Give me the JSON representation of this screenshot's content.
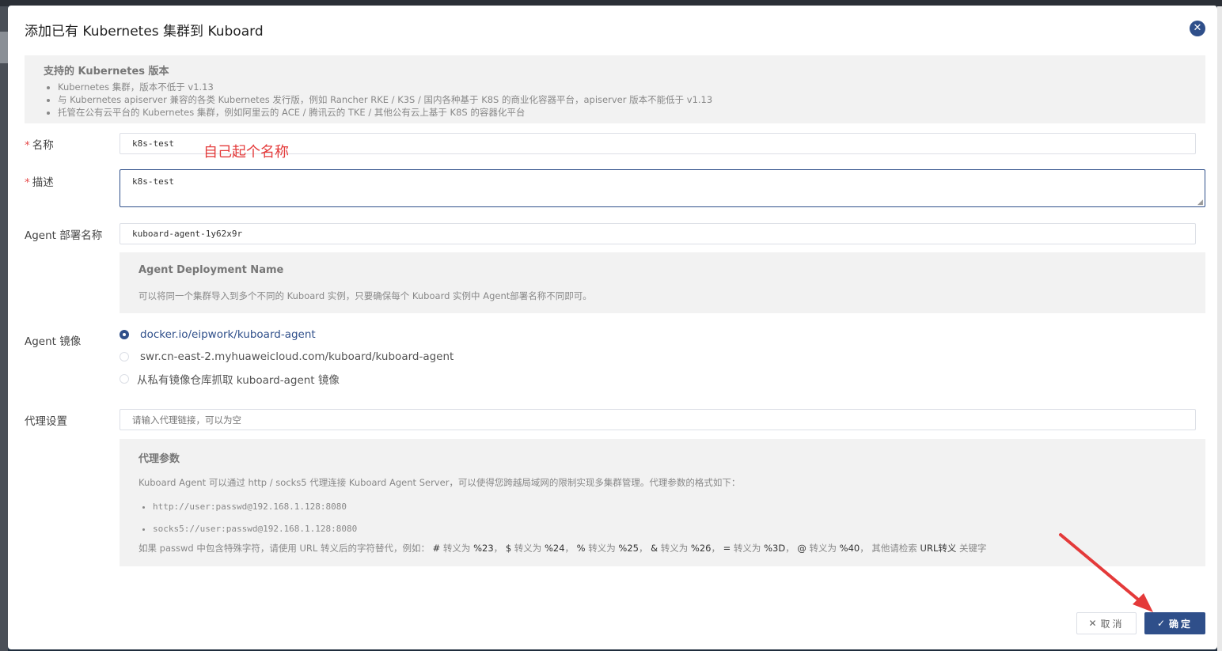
{
  "dialog": {
    "title": "添加已有 Kubernetes 集群到 Kuboard",
    "close_icon": "close-icon"
  },
  "supported": {
    "title": "支持的 Kubernetes 版本",
    "items": [
      "Kubernetes 集群，版本不低于 v1.13",
      "与 Kubernetes apiserver 兼容的各类 Kubernetes 发行版，例如 Rancher RKE / K3S / 国内各种基于 K8S 的商业化容器平台，apiserver 版本不能低于 v1.13",
      "托管在公有云平台的 Kubernetes 集群，例如阿里云的 ACE / 腾讯云的 TKE / 其他公有云上基于 K8S 的容器化平台"
    ]
  },
  "form": {
    "required_mark": "*",
    "name_label": "名称",
    "name_value": "k8s-test",
    "name_annotation": "自己起个名称",
    "desc_label": "描述",
    "desc_value": "k8s-test",
    "agent_name_label": "Agent 部署名称",
    "agent_name_value": "kuboard-agent-1y62x9r",
    "agent_hint_title": "Agent Deployment Name",
    "agent_hint_text": "可以将同一个集群导入到多个不同的 Kuboard 实例，只要确保每个 Kuboard 实例中 Agent部署名称不同即可。",
    "image_label": "Agent 镜像",
    "image_options": [
      "docker.io/eipwork/kuboard-agent",
      "swr.cn-east-2.myhuaweicloud.com/kuboard/kuboard-agent",
      "从私有镜像仓库抓取 kuboard-agent 镜像"
    ],
    "image_selected": "docker.io/eipwork/kuboard-agent",
    "proxy_label": "代理设置",
    "proxy_placeholder": "请输入代理链接，可以为空",
    "proxy_hint_title": "代理参数",
    "proxy_hint_text": "Kuboard Agent 可以通过 http / socks5 代理连接 Kuboard Agent Server，可以使得您跨越局域网的限制实现多集群管理。代理参数的格式如下：",
    "proxy_examples": [
      "http://user:passwd@192.168.1.128:8080",
      "socks5://user:passwd@192.168.1.128:8080"
    ],
    "escape_note": {
      "prefix": "如果 passwd 中包含特殊字符，请使用 URL 转义后的字符替代，例如：",
      "pairs": [
        {
          "char": "#",
          "mid": " 转义为 ",
          "code": "%23",
          "sep": "，"
        },
        {
          "char": "$",
          "mid": " 转义为 ",
          "code": "%24",
          "sep": "，"
        },
        {
          "char": "%",
          "mid": " 转义为 ",
          "code": "%25",
          "sep": "，"
        },
        {
          "char": "&",
          "mid": " 转义为 ",
          "code": "%26",
          "sep": "，"
        },
        {
          "char": "=",
          "mid": " 转义为 ",
          "code": "%3D",
          "sep": "，"
        },
        {
          "char": "@",
          "mid": " 转义为 ",
          "code": "%40",
          "sep": "，"
        }
      ],
      "suffix_pre": " 其他请检索 ",
      "suffix_key": "URL转义",
      "suffix_post": " 关键字"
    }
  },
  "buttons": {
    "cancel_label": "取消",
    "ok_label": "确定",
    "cancel_icon": "close-icon",
    "ok_icon": "check-icon"
  },
  "colors": {
    "primary": "#2f4f8a",
    "annotation": "#e43a3a",
    "required": "#e64a4a"
  }
}
